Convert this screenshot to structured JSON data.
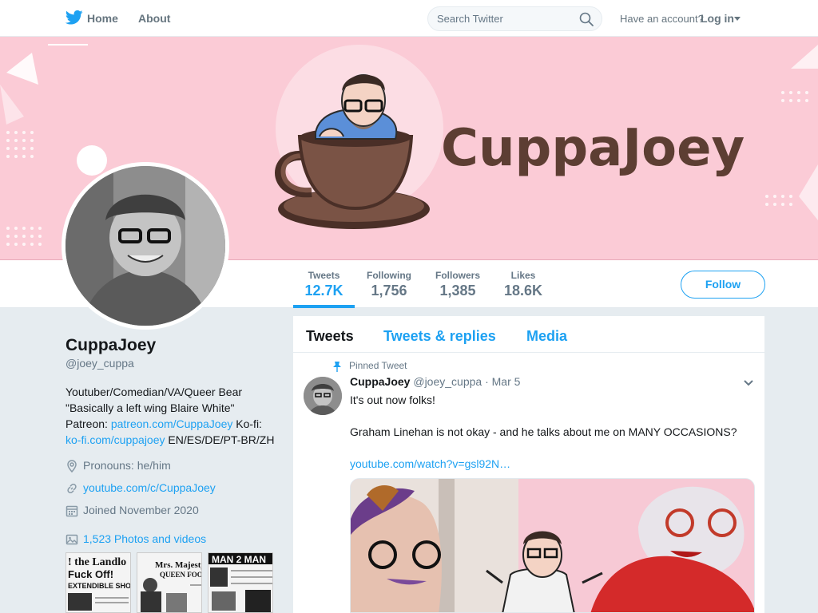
{
  "nav": {
    "home_label": "Home",
    "about_label": "About",
    "search_placeholder": "Search Twitter",
    "account_prompt": "Have an account?",
    "login_label": "Log in"
  },
  "banner": {
    "title": "CuppaJoey"
  },
  "stats": [
    {
      "label": "Tweets",
      "value": "12.7K"
    },
    {
      "label": "Following",
      "value": "1,756"
    },
    {
      "label": "Followers",
      "value": "1,385"
    },
    {
      "label": "Likes",
      "value": "18.6K"
    }
  ],
  "follow_label": "Follow",
  "profile": {
    "name": "CuppaJoey",
    "handle": "@joey_cuppa",
    "bio_line1": "Youtuber/Comedian/VA/Queer Bear",
    "bio_line2": "\"Basically a left wing Blaire White\"",
    "bio_patreon_prefix": "Patreon: ",
    "bio_patreon_link": "patreon.com/CuppaJoey",
    "bio_kofi_prefix": " Ko-fi:",
    "bio_kofi_link": "ko-fi.com/cuppajoey",
    "bio_languages": " EN/ES/DE/PT-BR/ZH",
    "pronouns": "Pronouns: he/him",
    "website": "youtube.com/c/CuppaJoey",
    "joined": "Joined November 2020",
    "media_count": "1,523 Photos and videos"
  },
  "thumbnails": [
    {
      "text": "! the Landlo\nFuck Off!\nEXTENDIBLE SHOES"
    },
    {
      "text": "Mrs. Majesty\nQUEEN FOOD"
    },
    {
      "text": "MAN 2 MAN"
    }
  ],
  "timeline": {
    "tabs": [
      "Tweets",
      "Tweets & replies",
      "Media"
    ],
    "pinned_label": "Pinned Tweet",
    "tweet": {
      "name": "CuppaJoey",
      "handle": "@joey_cuppa",
      "separator": "·",
      "date": "Mar 5",
      "line1": "It's out now folks!",
      "line2": "Graham Linehan is not okay - and he talks about me on MANY OCCASIONS?",
      "link": "youtube.com/watch?v=gsl92N…"
    }
  },
  "colors": {
    "accent": "#1da1f2",
    "banner_bg": "#fbcbd6",
    "brand_brown": "#5d3e33"
  },
  "icons": [
    "twitter-bird-icon",
    "search-icon",
    "pin-icon",
    "location-icon",
    "link-icon",
    "calendar-icon",
    "photo-icon",
    "chevron-down-icon"
  ]
}
